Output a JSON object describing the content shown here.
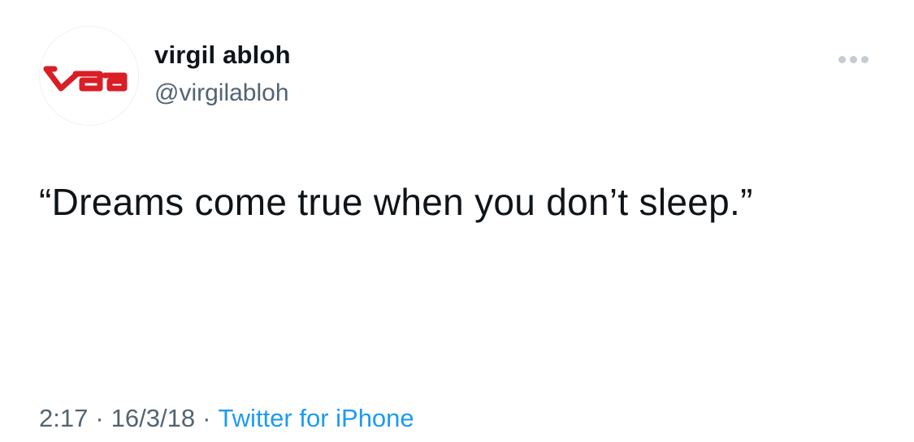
{
  "tweet": {
    "author": {
      "display_name": "virgil abloh",
      "handle": "@virgilabloh",
      "avatar_logo_text": "VAA",
      "avatar_logo_color": "#d81f26"
    },
    "more_icon": "more-horizontal-icon",
    "text": "“Dreams come true when you don’t sleep.”",
    "meta": {
      "time": "2:17",
      "separator": "·",
      "date": "16/3/18",
      "source": "Twitter for iPhone"
    }
  },
  "colors": {
    "text_primary": "#0f1419",
    "text_secondary": "#536471",
    "link": "#1d9bf0",
    "logo_red": "#d81f26"
  }
}
